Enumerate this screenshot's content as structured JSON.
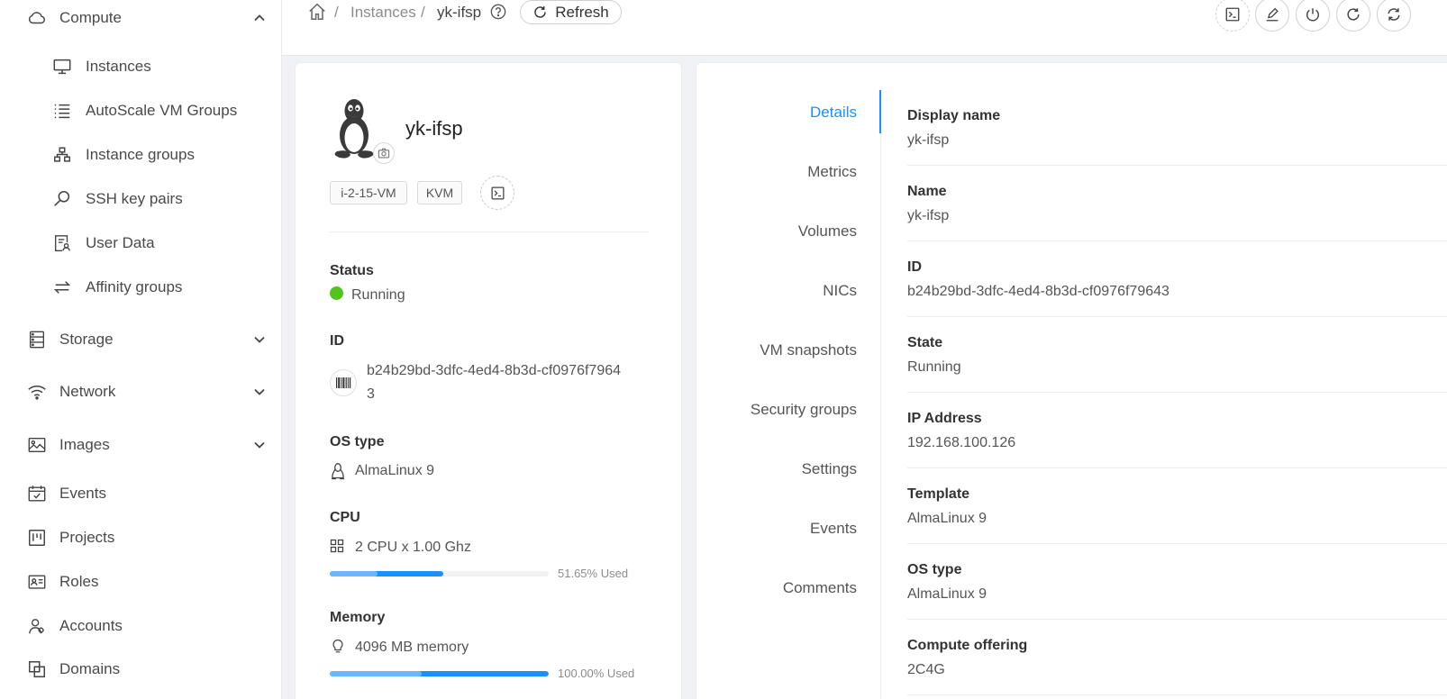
{
  "sidebar": {
    "compute": {
      "label": "Compute",
      "icon": "cloud-icon"
    },
    "compute_items": [
      {
        "label": "Instances",
        "icon": "desktop-icon"
      },
      {
        "label": "AutoScale VM Groups",
        "icon": "list-icon"
      },
      {
        "label": "Instance groups",
        "icon": "cluster-icon"
      },
      {
        "label": "SSH key pairs",
        "icon": "key-icon"
      },
      {
        "label": "User Data",
        "icon": "user-data-icon"
      },
      {
        "label": "Affinity groups",
        "icon": "swap-icon"
      }
    ],
    "sections": [
      {
        "label": "Storage",
        "icon": "database-icon"
      },
      {
        "label": "Network",
        "icon": "wifi-icon"
      },
      {
        "label": "Images",
        "icon": "picture-icon"
      },
      {
        "label": "Events",
        "icon": "schedule-icon"
      },
      {
        "label": "Projects",
        "icon": "project-icon"
      },
      {
        "label": "Roles",
        "icon": "idcard-icon"
      },
      {
        "label": "Accounts",
        "icon": "team-icon"
      },
      {
        "label": "Domains",
        "icon": "block-icon"
      }
    ]
  },
  "header": {
    "breadcrumb": [
      "Instances",
      "yk-ifsp"
    ],
    "separator": "/",
    "refresh_label": "Refresh"
  },
  "vm": {
    "name": "yk-ifsp",
    "tags": [
      "i-2-15-VM",
      "KVM"
    ],
    "status_label": "Status",
    "status": "Running",
    "status_color": "#52c41a",
    "id_label": "ID",
    "id_line1": "b24b29bd-3dfc-4ed4-8b3d-cf0976f7964",
    "id_line2": "3",
    "os_label": "OS type",
    "os": "AlmaLinux 9",
    "cpu_label": "CPU",
    "cpu": "2 CPU x 1.00 Ghz",
    "cpu_used_pct": 51.65,
    "cpu_used_text": "51.65% Used",
    "memory_label": "Memory",
    "memory": "4096 MB memory",
    "memory_used_pct": 100,
    "memory_used_text": "100.00% Used"
  },
  "tabs": [
    "Details",
    "Metrics",
    "Volumes",
    "NICs",
    "VM snapshots",
    "Security groups",
    "Settings",
    "Events",
    "Comments"
  ],
  "details": [
    {
      "label": "Display name",
      "value": "yk-ifsp"
    },
    {
      "label": "Name",
      "value": "yk-ifsp"
    },
    {
      "label": "ID",
      "value": "b24b29bd-3dfc-4ed4-8b3d-cf0976f79643"
    },
    {
      "label": "State",
      "value": "Running"
    },
    {
      "label": "IP Address",
      "value": "192.168.100.126"
    },
    {
      "label": "Template",
      "value": "AlmaLinux 9"
    },
    {
      "label": "OS type",
      "value": "AlmaLinux 9"
    },
    {
      "label": "Compute offering",
      "value": "2C4G"
    }
  ],
  "colors": {
    "accent": "#1890ff",
    "running": "#52c41a"
  }
}
